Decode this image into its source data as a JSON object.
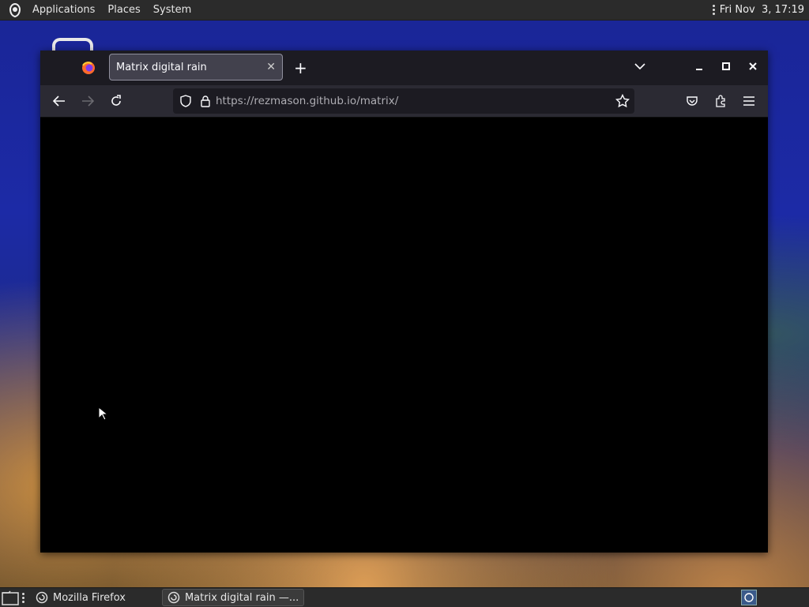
{
  "topbar": {
    "menus": [
      "Applications",
      "Places",
      "System"
    ],
    "clock": "Fri Nov  3, 17:19"
  },
  "browser": {
    "tab_title": "Matrix digital rain",
    "url_host": "https://rezmason.github.io",
    "url_path": "/matrix/"
  },
  "taskbar": {
    "items": [
      "Mozilla Firefox",
      "Matrix digital rain —..."
    ]
  },
  "colors": {
    "page_background": "#000000",
    "toolbar": "#2b2a33",
    "tabbar": "#1c1b22"
  }
}
